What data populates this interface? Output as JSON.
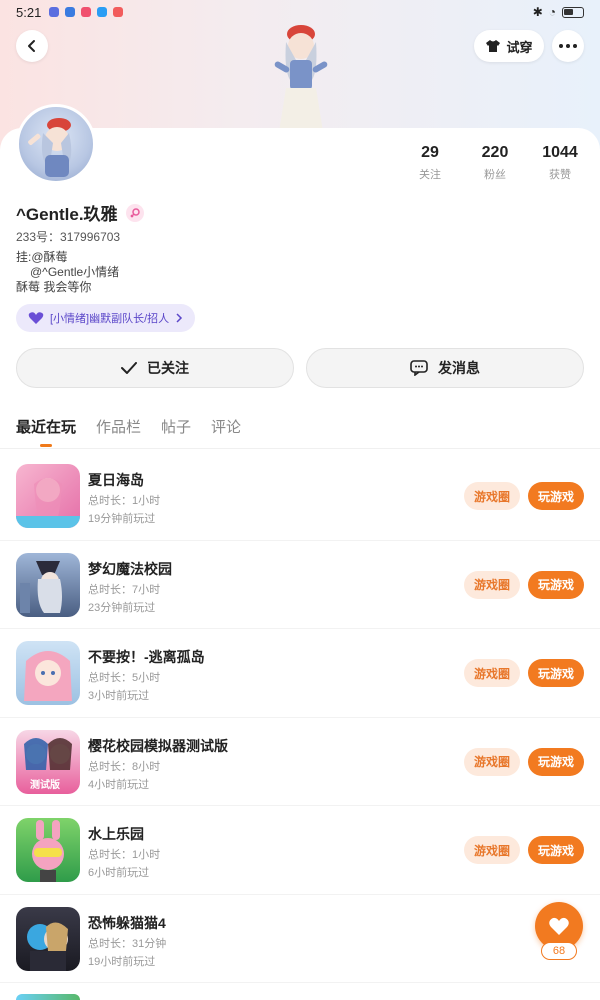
{
  "status_bar": {
    "time": "5:21"
  },
  "header": {
    "try_on_label": "试穿"
  },
  "profile": {
    "following_count": "29",
    "following_label": "关注",
    "fans_count": "220",
    "fans_label": "粉丝",
    "likes_count": "1044",
    "likes_label": "获赞",
    "username": "^Gentle.玖雅",
    "uid": "233号：317996703",
    "bio_line1": "挂:@酥莓",
    "bio_line2": "@^Gentle小情绪",
    "bio_line3": "酥莓 我会等你",
    "club_tag": "[小情绪]幽默副队长/招人"
  },
  "actions": {
    "follow_label": "已关注",
    "message_label": "发消息"
  },
  "tabs": [
    {
      "label": "最近在玩"
    },
    {
      "label": "作品栏"
    },
    {
      "label": "帖子"
    },
    {
      "label": "评论"
    }
  ],
  "games": [
    {
      "name": "夏日海岛",
      "duration": "总时长：1小时",
      "last_played": "19分钟前玩过",
      "circle_label": "游戏圈",
      "play_label": "玩游戏"
    },
    {
      "name": "梦幻魔法校园",
      "duration": "总时长：7小时",
      "last_played": "23分钟前玩过",
      "circle_label": "游戏圈",
      "play_label": "玩游戏"
    },
    {
      "name": "不要按！-逃离孤岛",
      "duration": "总时长：5小时",
      "last_played": "3小时前玩过",
      "circle_label": "游戏圈",
      "play_label": "玩游戏"
    },
    {
      "name": "樱花校园模拟器测试版",
      "duration": "总时长：8小时",
      "last_played": "4小时前玩过",
      "circle_label": "游戏圈",
      "play_label": "玩游戏",
      "icon_text": "测试版"
    },
    {
      "name": "水上乐园",
      "duration": "总时长：1小时",
      "last_played": "6小时前玩过",
      "circle_label": "游戏圈",
      "play_label": "玩游戏"
    },
    {
      "name": "恐怖躲猫猫4",
      "duration": "总时长：31分钟",
      "last_played": "19小时前玩过"
    }
  ],
  "fab": {
    "count": "68"
  },
  "colors": {
    "accent": "#f27a20",
    "accent_light": "#fde9dc",
    "club_tag_bg": "#ece9fb",
    "club_tag_text": "#5b47c9"
  }
}
